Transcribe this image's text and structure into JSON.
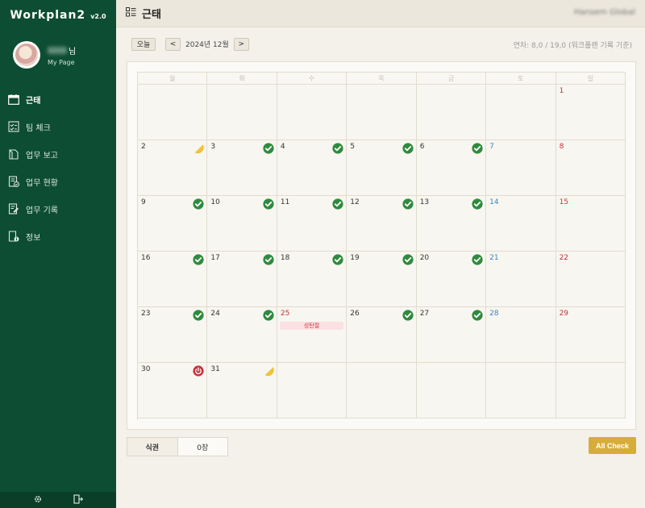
{
  "app": {
    "name": "Workplan2",
    "version": "v2.0"
  },
  "profile": {
    "name_suffix": "님",
    "subtitle": "My Page"
  },
  "nav": [
    {
      "label": "근태",
      "icon": "calendar-icon",
      "active": true
    },
    {
      "label": "팀 체크",
      "icon": "team-check-icon",
      "active": false
    },
    {
      "label": "업무 보고",
      "icon": "report-icon",
      "active": false
    },
    {
      "label": "업무 현황",
      "icon": "status-icon",
      "active": false
    },
    {
      "label": "업무 기록",
      "icon": "record-icon",
      "active": false
    },
    {
      "label": "정보",
      "icon": "info-icon",
      "active": false
    }
  ],
  "header": {
    "title": "근태",
    "company": "Hansem Global"
  },
  "toolbar": {
    "today_label": "오늘",
    "prev_label": "<",
    "next_label": ">",
    "month_label": "2024년 12월",
    "summary": "연차: 8,0 / 19,0 (워크플랜 기록 기준)"
  },
  "calendar": {
    "weekdays": [
      "월",
      "화",
      "수",
      "목",
      "금",
      "토",
      "일"
    ],
    "weeks": [
      [
        null,
        null,
        null,
        null,
        null,
        null,
        {
          "day": "1",
          "kind": "sun"
        }
      ],
      [
        {
          "day": "2",
          "status": "half"
        },
        {
          "day": "3",
          "status": "check"
        },
        {
          "day": "4",
          "status": "check"
        },
        {
          "day": "5",
          "status": "check"
        },
        {
          "day": "6",
          "status": "check"
        },
        {
          "day": "7",
          "kind": "sat"
        },
        {
          "day": "8",
          "kind": "sun"
        }
      ],
      [
        {
          "day": "9",
          "status": "check"
        },
        {
          "day": "10",
          "status": "check"
        },
        {
          "day": "11",
          "status": "check"
        },
        {
          "day": "12",
          "status": "check"
        },
        {
          "day": "13",
          "status": "check"
        },
        {
          "day": "14",
          "kind": "sat"
        },
        {
          "day": "15",
          "kind": "sun"
        }
      ],
      [
        {
          "day": "16",
          "status": "check"
        },
        {
          "day": "17",
          "status": "check"
        },
        {
          "day": "18",
          "status": "check"
        },
        {
          "day": "19",
          "status": "check"
        },
        {
          "day": "20",
          "status": "check"
        },
        {
          "day": "21",
          "kind": "sat"
        },
        {
          "day": "22",
          "kind": "sun"
        }
      ],
      [
        {
          "day": "23",
          "status": "check"
        },
        {
          "day": "24",
          "status": "check"
        },
        {
          "day": "25",
          "kind": "hol",
          "holiday": "성탄절"
        },
        {
          "day": "26",
          "status": "check"
        },
        {
          "day": "27",
          "status": "check"
        },
        {
          "day": "28",
          "kind": "sat"
        },
        {
          "day": "29",
          "kind": "sun"
        }
      ],
      [
        {
          "day": "30",
          "status": "power"
        },
        {
          "day": "31",
          "status": "half"
        },
        null,
        null,
        null,
        null,
        null
      ]
    ]
  },
  "meal": {
    "label": "식권",
    "value": "0장"
  },
  "actions": {
    "all_check": "All Check"
  },
  "colors": {
    "sidebar": "#0d4d33",
    "check": "#2e8b3e",
    "off": "#c9323a",
    "half": "#f2c434",
    "button": "#d7ad3a",
    "saturday": "#3a87c8",
    "sunday": "#c9323a"
  }
}
